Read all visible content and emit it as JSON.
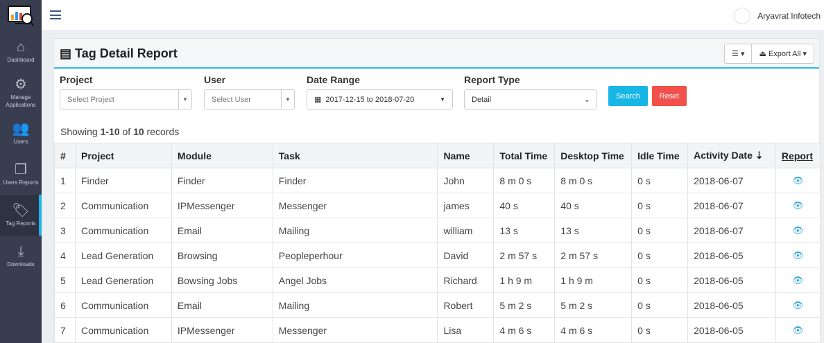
{
  "sidebar": {
    "items": [
      {
        "label": "Dashboard",
        "icon": "home-icon"
      },
      {
        "label": "Manage Applications",
        "icon": "gears-icon"
      },
      {
        "label": "Users",
        "icon": "users-icon"
      },
      {
        "label": "Users Reports",
        "icon": "copy-icon"
      },
      {
        "label": "Tag Reports",
        "icon": "tags-icon",
        "active": true
      },
      {
        "label": "Downloads",
        "icon": "download-icon"
      }
    ]
  },
  "header": {
    "user": "Aryavrat Infotech"
  },
  "panel": {
    "title": "Tag Detail Report",
    "export_label": "Export All"
  },
  "filters": {
    "project": {
      "label": "Project",
      "placeholder": "Select Project"
    },
    "user": {
      "label": "User",
      "placeholder": "Select User"
    },
    "date": {
      "label": "Date Range",
      "value": "2017-12-15 to 2018-07-20"
    },
    "type": {
      "label": "Report Type",
      "value": "Detail"
    },
    "search": "Search",
    "reset": "Reset"
  },
  "summary": {
    "prefix": "Showing ",
    "range": "1-10",
    "mid": " of ",
    "total": "10",
    "suffix": " records"
  },
  "table": {
    "headers": [
      "#",
      "Project",
      "Module",
      "Task",
      "Name",
      "Total Time",
      "Desktop Time",
      "Idle Time",
      "Activity Date",
      "Report"
    ],
    "rows": [
      [
        "1",
        "Finder",
        "Finder",
        "Finder",
        "John",
        "8 m 0 s",
        "8 m 0 s",
        "0 s",
        "2018-06-07"
      ],
      [
        "2",
        "Communication",
        "IPMessenger",
        "Messenger",
        "james",
        "40 s",
        "40 s",
        "0 s",
        "2018-06-07"
      ],
      [
        "3",
        "Communication",
        "Email",
        "Mailing",
        "william",
        "13 s",
        "13 s",
        "0 s",
        "2018-06-07"
      ],
      [
        "4",
        "Lead Generation",
        "Browsing",
        "Peopleperhour",
        "David",
        "2 m 57 s",
        "2 m 57 s",
        "0 s",
        "2018-06-05"
      ],
      [
        "5",
        "Lead Generation",
        "Bowsing Jobs",
        "Angel Jobs",
        "Richard",
        "1 h 9 m",
        "1 h 9 m",
        "0 s",
        "2018-06-05"
      ],
      [
        "6",
        "Communication",
        "Email",
        "Mailing",
        "Robert",
        "5 m 2 s",
        "5 m 2 s",
        "0 s",
        "2018-06-05"
      ],
      [
        "7",
        "Communication",
        "IPMessenger",
        "Messenger",
        "Lisa",
        "4 m 6 s",
        "4 m 6 s",
        "0 s",
        "2018-06-05"
      ]
    ]
  },
  "colors": {
    "sidebar": "#383d4f",
    "accent": "#1fb5e8",
    "search": "#17b6e4",
    "reset": "#f2504b"
  }
}
